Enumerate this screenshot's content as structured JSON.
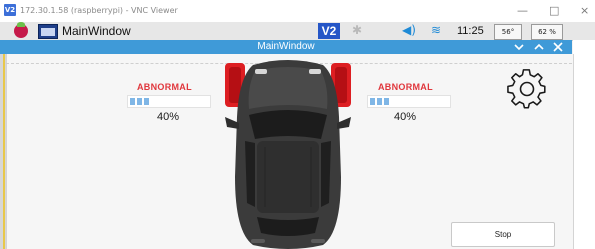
{
  "vnc": {
    "logo": "V2",
    "title": "172.30.1.58 (raspberrypi) - VNC Viewer",
    "controls": [
      "—",
      "□",
      "×"
    ]
  },
  "taskbar": {
    "task_label": "MainWindow",
    "clock": "11:25",
    "temperature": "56°",
    "cpu": "62 %"
  },
  "app": {
    "title": "MainWindow",
    "left": {
      "status": "ABNORMAL",
      "percent_label": "40%",
      "percent": 40
    },
    "right": {
      "status": "ABNORMAL",
      "percent_label": "40%",
      "percent": 40
    },
    "stop_label": "Stop"
  },
  "colors": {
    "accent": "#3f9ad8",
    "alert_red": "#e0363c",
    "wheel_red": "#dd1e22",
    "bar_fill": "#7fb6e6"
  },
  "icons": [
    "raspberry-pi-icon",
    "window-icon",
    "vnc-icon",
    "bluetooth-icon",
    "volume-icon",
    "wifi-icon",
    "gear-icon",
    "car-icon"
  ]
}
